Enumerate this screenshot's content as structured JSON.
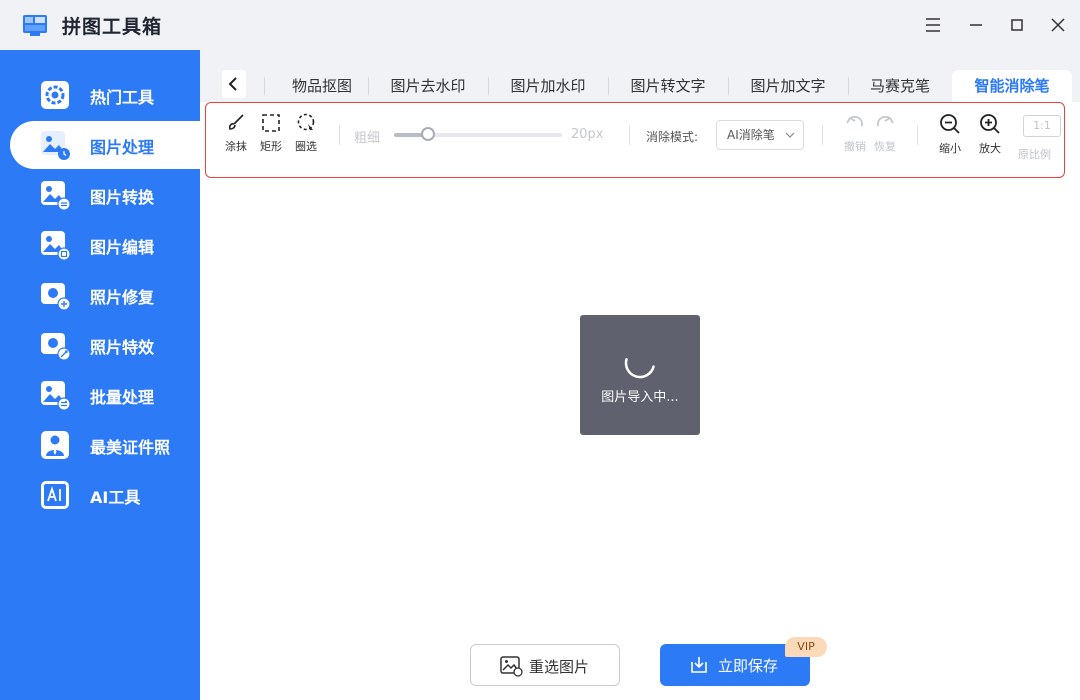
{
  "app": {
    "title": "拼图工具箱"
  },
  "window_controls": {
    "menu": "menu-icon",
    "minimize": "minimize-icon",
    "maximize": "maximize-icon",
    "close": "close-icon"
  },
  "sidebar": {
    "active_index": 1,
    "items": [
      {
        "label": "热门工具",
        "icon": "gear-icon"
      },
      {
        "label": "图片处理",
        "icon": "image-process-icon"
      },
      {
        "label": "图片转换",
        "icon": "image-convert-icon"
      },
      {
        "label": "图片编辑",
        "icon": "image-edit-icon"
      },
      {
        "label": "照片修复",
        "icon": "photo-repair-icon"
      },
      {
        "label": "照片特效",
        "icon": "photo-effect-icon"
      },
      {
        "label": "批量处理",
        "icon": "batch-icon"
      },
      {
        "label": "最美证件照",
        "icon": "id-photo-icon"
      },
      {
        "label": "AI工具",
        "icon": "ai-icon"
      }
    ]
  },
  "tabs": {
    "items": [
      "物品抠图",
      "图片去水印",
      "图片加水印",
      "图片转文字",
      "图片加文字",
      "马赛克笔",
      "智能消除笔"
    ],
    "active_index": 6
  },
  "toolbar": {
    "smear": "涂抹",
    "rect": "矩形",
    "lasso": "圈选",
    "thickness_label": "粗细",
    "thickness_value": "20px",
    "thickness_fraction": 0.2,
    "mode_label": "消除模式:",
    "mode_value": "AI消除笔",
    "undo": "撤销",
    "redo": "恢复",
    "zoom_out": "缩小",
    "zoom_in": "放大",
    "ratio_box": "1:1",
    "ratio_label": "原比例"
  },
  "loading": {
    "text": "图片导入中..."
  },
  "bottom": {
    "reselect": "重选图片",
    "save": "立即保存",
    "vip": "VIP"
  },
  "colors": {
    "accent": "#2d7af7",
    "highlight_border": "#e0463d",
    "loading_bg": "#5f626e",
    "vip_bg": "#fcd9b8"
  }
}
